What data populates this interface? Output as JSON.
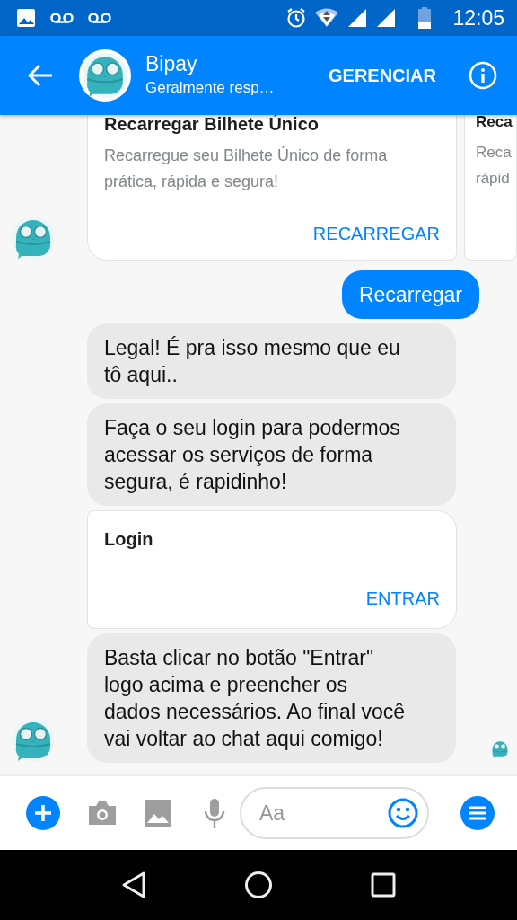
{
  "status_bar": {
    "time": "12:05"
  },
  "header": {
    "name": "Bipay",
    "subtitle": "Geralmente resp…",
    "action": "GERENCIAR"
  },
  "messages": [
    {
      "kind": "carousel",
      "show_avatar": true,
      "cards": [
        {
          "title": "Recarregar Bilhete Único",
          "lines": [
            "Recarregue seu Bilhete Único de forma",
            "prática, rápida e segura!"
          ],
          "button": "RECARREGAR"
        },
        {
          "title": "Reca",
          "lines": [
            "Reca",
            "rápid"
          ]
        }
      ]
    },
    {
      "kind": "outgoing",
      "lines": [
        "Recarregar"
      ]
    },
    {
      "kind": "incoming",
      "show_avatar": false,
      "lines": [
        "Legal! É pra isso mesmo que eu",
        "tô aqui.."
      ]
    },
    {
      "kind": "incoming",
      "show_avatar": false,
      "lines": [
        "Faça o seu login para podermos",
        "acessar os serviços de forma",
        "segura, é rapidinho!"
      ]
    },
    {
      "kind": "login-card",
      "title": "Login",
      "button": "ENTRAR"
    },
    {
      "kind": "incoming",
      "show_avatar": true,
      "seen": true,
      "lines": [
        "Basta clicar no botão \"Entrar\"",
        "logo acima e preencher os",
        "dados necessários. Ao final você",
        "vai voltar ao chat aqui comigo!"
      ]
    }
  ],
  "composer": {
    "placeholder": "Aa"
  }
}
